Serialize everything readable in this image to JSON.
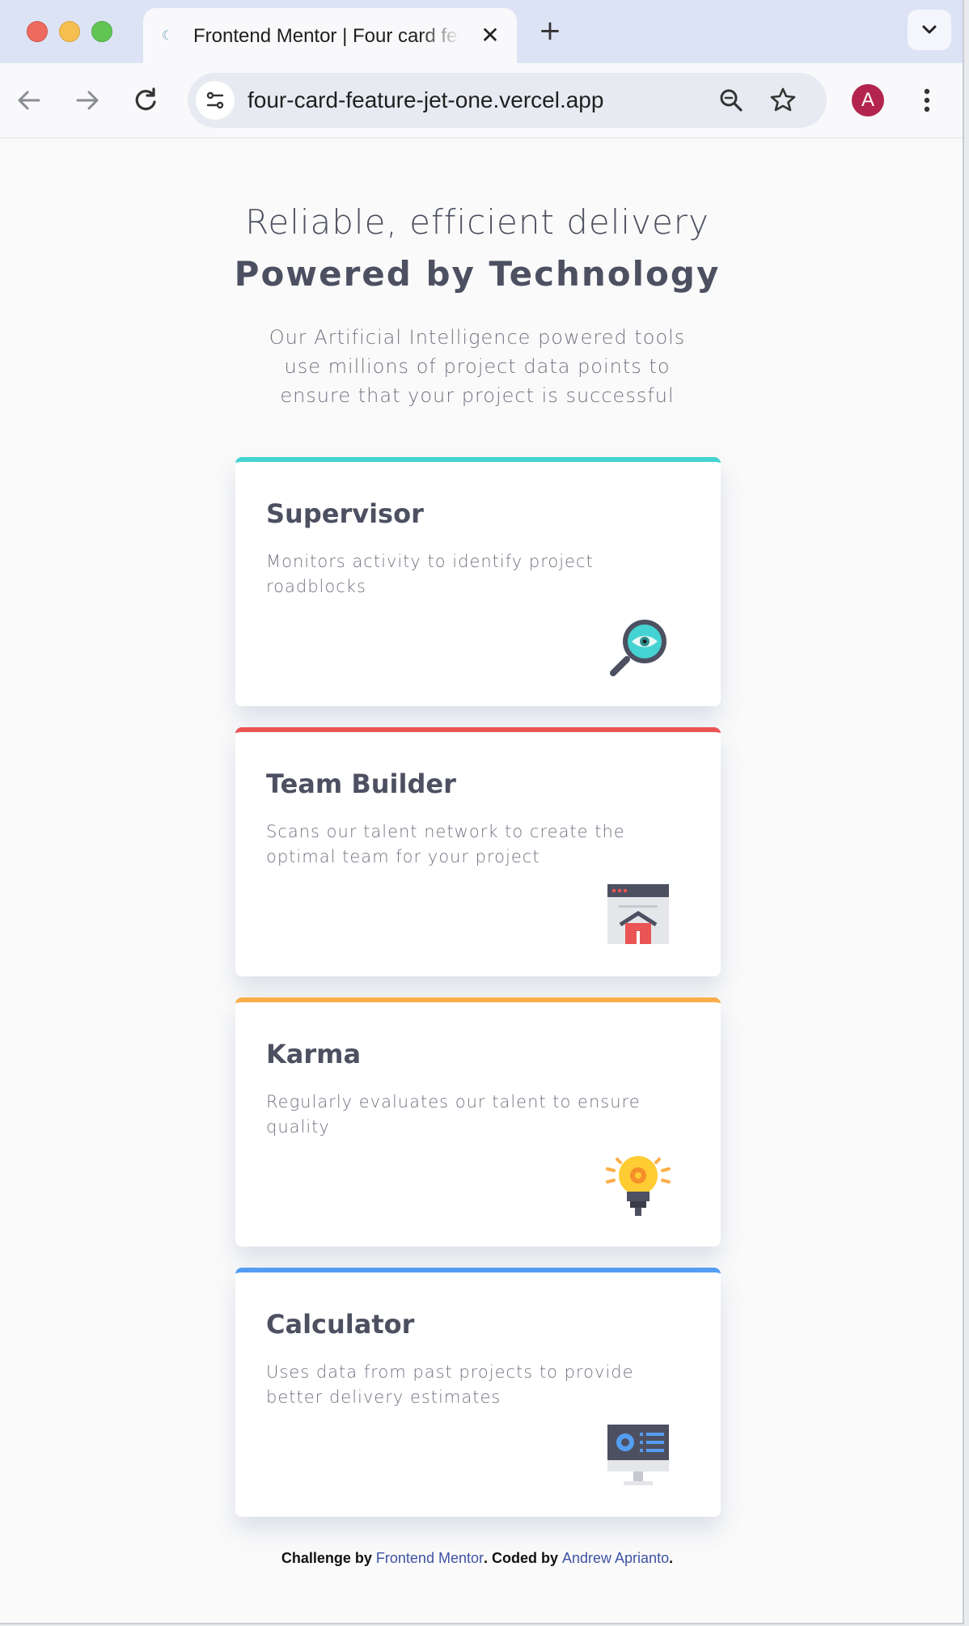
{
  "browser": {
    "tab_title": "Frontend Mentor | Four card feature section",
    "url": "four-card-feature-jet-one.vercel.app",
    "profile_initial": "A",
    "colors": {
      "profile": "#b3244f"
    }
  },
  "page": {
    "headline_light": "Reliable, efficient delivery",
    "headline_bold": "Powered by Technology",
    "intro": "Our Artificial Intelligence powered tools use millions of project data points to ensure that your project is successful",
    "cards": [
      {
        "title": "Supervisor",
        "description": "Monitors activity to identify project roadblocks",
        "icon": "magnifier-eye-icon",
        "accent": "#44d3d2"
      },
      {
        "title": "Team Builder",
        "description": "Scans our talent network to create the optimal team for your project",
        "icon": "team-builder-icon",
        "accent": "#ea5454"
      },
      {
        "title": "Karma",
        "description": "Regularly evaluates our talent to ensure quality",
        "icon": "lightbulb-icon",
        "accent": "#fcae4a"
      },
      {
        "title": "Calculator",
        "description": "Uses data from past projects to provide better delivery estimates",
        "icon": "calculator-monitor-icon",
        "accent": "#549ef2"
      }
    ],
    "attribution": {
      "prefix": "Challenge by ",
      "link1": "Frontend Mentor",
      "middle": ". Coded by ",
      "link2": "Andrew Aprianto",
      "suffix": "."
    }
  }
}
